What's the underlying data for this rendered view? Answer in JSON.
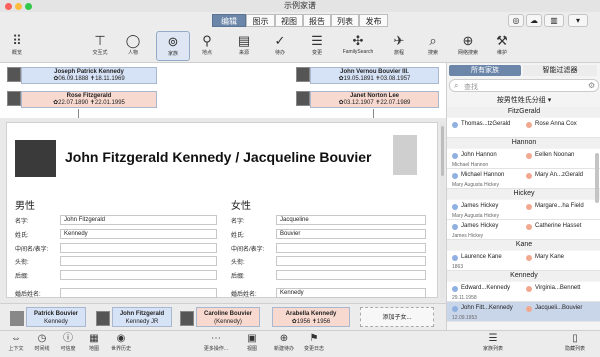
{
  "window_title": "示例家谱",
  "tabs": [
    "编辑",
    "图示",
    "视图",
    "报告",
    "列表",
    "发布"
  ],
  "toolbar": [
    "概览",
    "交互式",
    "人物",
    "家族",
    "地点",
    "来源",
    "待办",
    "变更",
    "FamilySearch",
    "旅程",
    "搜索",
    "网络搜索",
    "维护"
  ],
  "tree": {
    "p1": {
      "name": "Joseph Patrick Kennedy",
      "dates": "✿06.09.1888 ✝18.11.1969"
    },
    "p2": {
      "name": "Rose Fitzgerald",
      "dates": "✿22.07.1890 ✝22.01.1995"
    },
    "p3": {
      "name": "John Vernou Bouvier III.",
      "dates": "✿19.05.1891 ✝03.08.1957"
    },
    "p4": {
      "name": "Janet Norton Lee",
      "dates": "✿03.12.1907 ✝22.07.1989"
    }
  },
  "card": {
    "family_title": "John Fitzgerald Kennedy / Jacqueline Bouvier",
    "male_label": "男性",
    "female_label": "女性",
    "field_labels": [
      "名字:",
      "姓氏:",
      "中间名/表字:",
      "头衔:",
      "后缀:",
      "婚后姓名:"
    ],
    "male_values": [
      "John Fitzgerald",
      "Kennedy",
      "",
      "",
      "",
      ""
    ],
    "female_values": [
      "Jacqueline",
      "Bouvier",
      "",
      "",
      "",
      "Kennedy"
    ]
  },
  "strip": [
    {
      "name": "Patrick Bouvier",
      "sub": "Kennedy"
    },
    {
      "name": "John Fitzgerald",
      "sub": "Kennedy JR"
    },
    {
      "name": "Caroline Bouvier",
      "sub": "(Kennedy)"
    },
    {
      "name": "Arabella Kennedy",
      "sub": "✿1956 ✝1956"
    },
    {
      "name": "添加子女...",
      "sub": ""
    }
  ],
  "bottombar": [
    "上下文",
    "时间线",
    "可信度",
    "地图",
    "世界历史",
    "更多操作...",
    "视图",
    "新建待办",
    "变更日志",
    "家族列表",
    "隐藏列表"
  ],
  "side": {
    "tabs": [
      "所有家族",
      "智能过滤器"
    ],
    "search_placeholder": "查找",
    "sort_label": "按男性姓氏分组",
    "groups": [
      {
        "title": "FitzGerald",
        "rows": [
          {
            "m": "Thomas...tzGerald",
            "f": "Rose Anna Cox",
            "date": ""
          }
        ]
      },
      {
        "title": "Hannon",
        "rows": [
          {
            "m": "John Hannon",
            "f": "Eellen Noonan",
            "date": "Michael Hannon"
          },
          {
            "m": "Michael Hannon",
            "f": "Mary An...zGerald",
            "date": "Mary Augusta Hickey"
          }
        ]
      },
      {
        "title": "Hickey",
        "rows": [
          {
            "m": "James Hickey",
            "f": "Margare...ha Field",
            "date": "Mary Augusta Hickey"
          },
          {
            "m": "James Hickey",
            "f": "Catherine Hasset",
            "date": "James Hickey"
          }
        ]
      },
      {
        "title": "Kane",
        "rows": [
          {
            "m": "Laurence Kane",
            "f": "Mary Kane",
            "date": "1863"
          }
        ]
      },
      {
        "title": "Kennedy",
        "rows": [
          {
            "m": "Edward...Kennedy",
            "f": "Virginia...Bennett",
            "date": "29.11.1958"
          },
          {
            "m": "John Fitt...Kennedy",
            "f": "Jacqueli...Bouvier",
            "date": "12.09.1953"
          }
        ]
      }
    ]
  }
}
